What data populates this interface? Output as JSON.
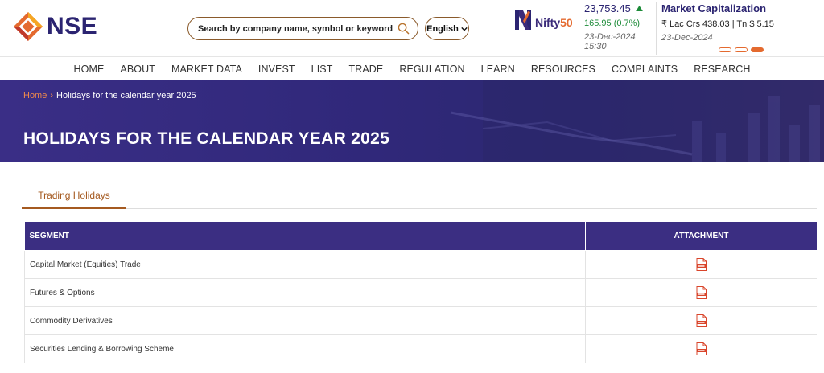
{
  "header": {
    "logo_text": "NSE",
    "search": {
      "placeholder": "Search by company name, symbol or keyword"
    },
    "language": {
      "selected": "English"
    },
    "nifty": {
      "brand_prefix": "Nifty",
      "brand_suffix": "50",
      "value": "23,753.45",
      "trend_icon": "up-arrow-icon",
      "change": "165.95 (0.7%)",
      "date": "23-Dec-2024 15:30"
    },
    "market_cap": {
      "title": "Market Capitalization",
      "values": "₹ Lac Crs 438.03 | Tn $ 5.15",
      "date": "23-Dec-2024"
    },
    "carousel": {
      "count": 3,
      "active_index": 2
    }
  },
  "nav": {
    "items": [
      "HOME",
      "ABOUT",
      "MARKET DATA",
      "INVEST",
      "LIST",
      "TRADE",
      "REGULATION",
      "LEARN",
      "RESOURCES",
      "COMPLAINTS",
      "RESEARCH"
    ]
  },
  "banner": {
    "breadcrumb": {
      "home": "Home",
      "current": "Holidays for the calendar year 2025"
    },
    "title": "HOLIDAYS FOR THE CALENDAR YEAR 2025"
  },
  "tabs": {
    "active": "Trading Holidays"
  },
  "table": {
    "headers": {
      "segment": "SEGMENT",
      "attachment": "ATTACHMENT"
    },
    "rows": [
      {
        "segment": "Capital Market (Equities) Trade",
        "attachment_icon": "pdf-icon"
      },
      {
        "segment": "Futures & Options",
        "attachment_icon": "pdf-icon"
      },
      {
        "segment": "Commodity Derivatives",
        "attachment_icon": "pdf-icon"
      },
      {
        "segment": "Securities Lending & Borrowing Scheme",
        "attachment_icon": "pdf-icon"
      }
    ]
  },
  "colors": {
    "brand_navy": "#2b2471",
    "brand_orange": "#e46a2f",
    "positive_green": "#1c8b38",
    "table_header": "#3b2e82"
  }
}
